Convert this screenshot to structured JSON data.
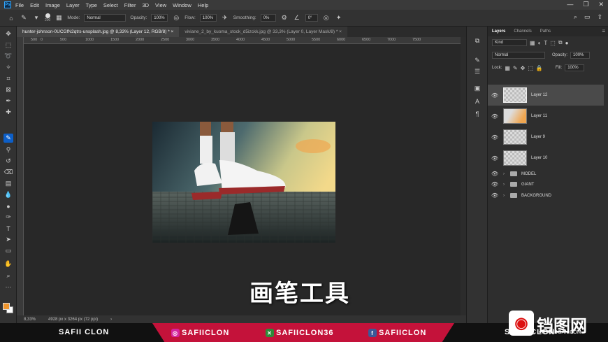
{
  "app": {
    "logo": "Ps"
  },
  "menu": [
    "File",
    "Edit",
    "Image",
    "Layer",
    "Type",
    "Select",
    "Filter",
    "3D",
    "View",
    "Window",
    "Help"
  ],
  "window_controls": [
    "—",
    "❐",
    "✕"
  ],
  "options": {
    "brush_size": "200",
    "mode_label": "Mode:",
    "mode_value": "Normal",
    "opacity_label": "Opacity:",
    "opacity_value": "100%",
    "flow_label": "Flow:",
    "flow_value": "100%",
    "smoothing_label": "Smoothing:",
    "smoothing_value": "0%",
    "angle_value": "0°"
  },
  "tabs": [
    {
      "label": "hunter-johnson-0UCGfN2qtrs-unsplash.jpg @ 8,33% (Layer 12, RGB/8) *  ×"
    },
    {
      "label": "viviane_2_by_kuoma_stock_d5izckk.jpg @ 33,3% (Layer 0, Layer Mask/8) *  ×"
    }
  ],
  "ruler_labels": [
    "500",
    "0",
    "500",
    "1000",
    "1500",
    "2000",
    "2500",
    "3000",
    "3500",
    "4000",
    "4500",
    "5000",
    "5500",
    "6000",
    "6500",
    "7000",
    "7500"
  ],
  "status": {
    "zoom": "8,33%",
    "doc_info": "4928 px x 3264 px (72 ppi)",
    "arrow": "›"
  },
  "caption": "画笔工具",
  "layers_panel": {
    "tabs": [
      "Layers",
      "Channels",
      "Paths"
    ],
    "kind_label": "Kind",
    "blend_mode": "Normal",
    "opacity_label": "Opacity:",
    "opacity_value": "100%",
    "lock_label": "Lock:",
    "fill_label": "Fill:",
    "fill_value": "100%",
    "layers": [
      {
        "name": "Layer 12"
      },
      {
        "name": "Layer 11"
      },
      {
        "name": "Layer 9"
      },
      {
        "name": "Layer 10"
      }
    ],
    "groups": [
      {
        "name": "MODEL"
      },
      {
        "name": "GIANT"
      },
      {
        "name": "BACKGROUND"
      }
    ]
  },
  "footer": {
    "brand": "SAFII CLON",
    "instagram": "SAFIICLON",
    "other": "SAFIICLON36",
    "facebook": "SAFIICLON",
    "brand_right": "SAFII CLON"
  },
  "watermark": {
    "text": "铛图网",
    "sub": "TUANDOAN.COM"
  },
  "colors": {
    "accent": "#0d5fc8",
    "foreground": "#f0962e",
    "band": "#c4123a"
  }
}
